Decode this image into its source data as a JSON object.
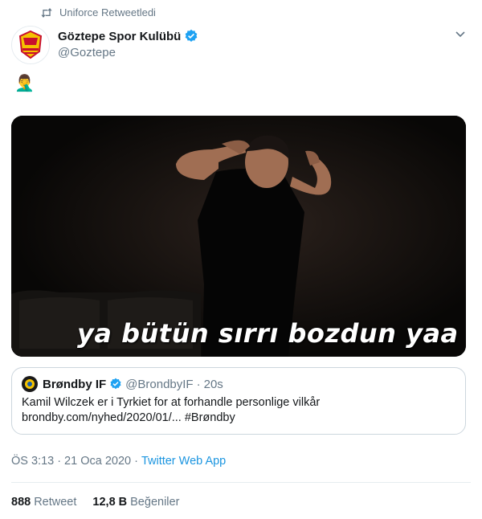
{
  "retweet_context": {
    "label": "Uniforce Retweetledi"
  },
  "author": {
    "name": "Göztepe Spor Kulübü",
    "handle": "@Goztepe"
  },
  "tweet": {
    "emoji": "🤦‍♂️"
  },
  "media": {
    "caption": "ya bütün sırrı bozdun yaa"
  },
  "quoted_tweet": {
    "name": "Brøndby IF",
    "handle": "@BrondbyIF",
    "separator": "·",
    "time": "20s",
    "line1": "Kamil Wilczek er i Tyrkiet for at forhandle personlige vilkår",
    "line2": "brondby.com/nyhed/2020/01/... #Brøndby"
  },
  "meta": {
    "time": "ÖS 3:13",
    "separator": "·",
    "date": "21 Oca 2020",
    "app": "Twitter Web App"
  },
  "stats": {
    "retweets_count": "888",
    "retweets_label": "Retweet",
    "likes_count": "12,8 B",
    "likes_label": "Beğeniler"
  },
  "colors": {
    "accent": "#1b95e0",
    "muted": "#657786",
    "brand_gold": "#f5c200",
    "brand_red": "#c8102e"
  }
}
